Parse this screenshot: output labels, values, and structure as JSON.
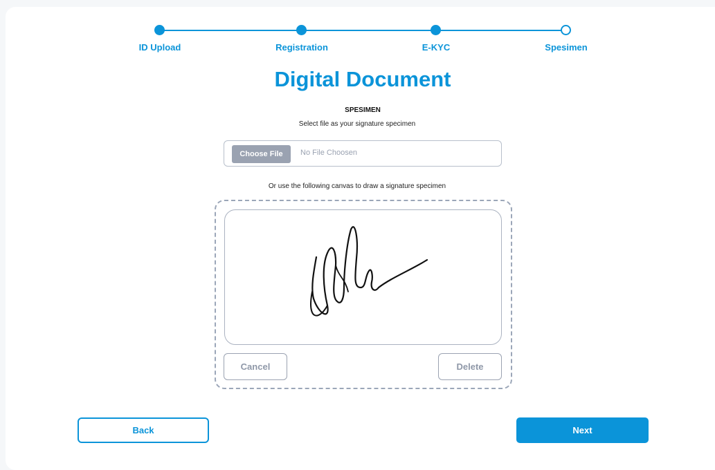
{
  "stepper": {
    "steps": [
      {
        "label": "ID Upload",
        "status": "complete"
      },
      {
        "label": "Registration",
        "status": "complete"
      },
      {
        "label": "E-KYC",
        "status": "complete"
      },
      {
        "label": "Spesimen",
        "status": "current"
      }
    ],
    "color": "#0b94d9"
  },
  "page_title": "Digital Document",
  "specimen": {
    "heading": "SPESIMEN",
    "subtitle": "Select file as your signature specimen",
    "choose_file_label": "Choose File",
    "file_status": "No File Choosen",
    "canvas_hint": "Or use the following canvas to draw a signature specimen",
    "cancel_label": "Cancel",
    "delete_label": "Delete"
  },
  "nav": {
    "back_label": "Back",
    "next_label": "Next"
  },
  "colors": {
    "accent": "#0b94d9",
    "muted": "#9aa2b1"
  }
}
